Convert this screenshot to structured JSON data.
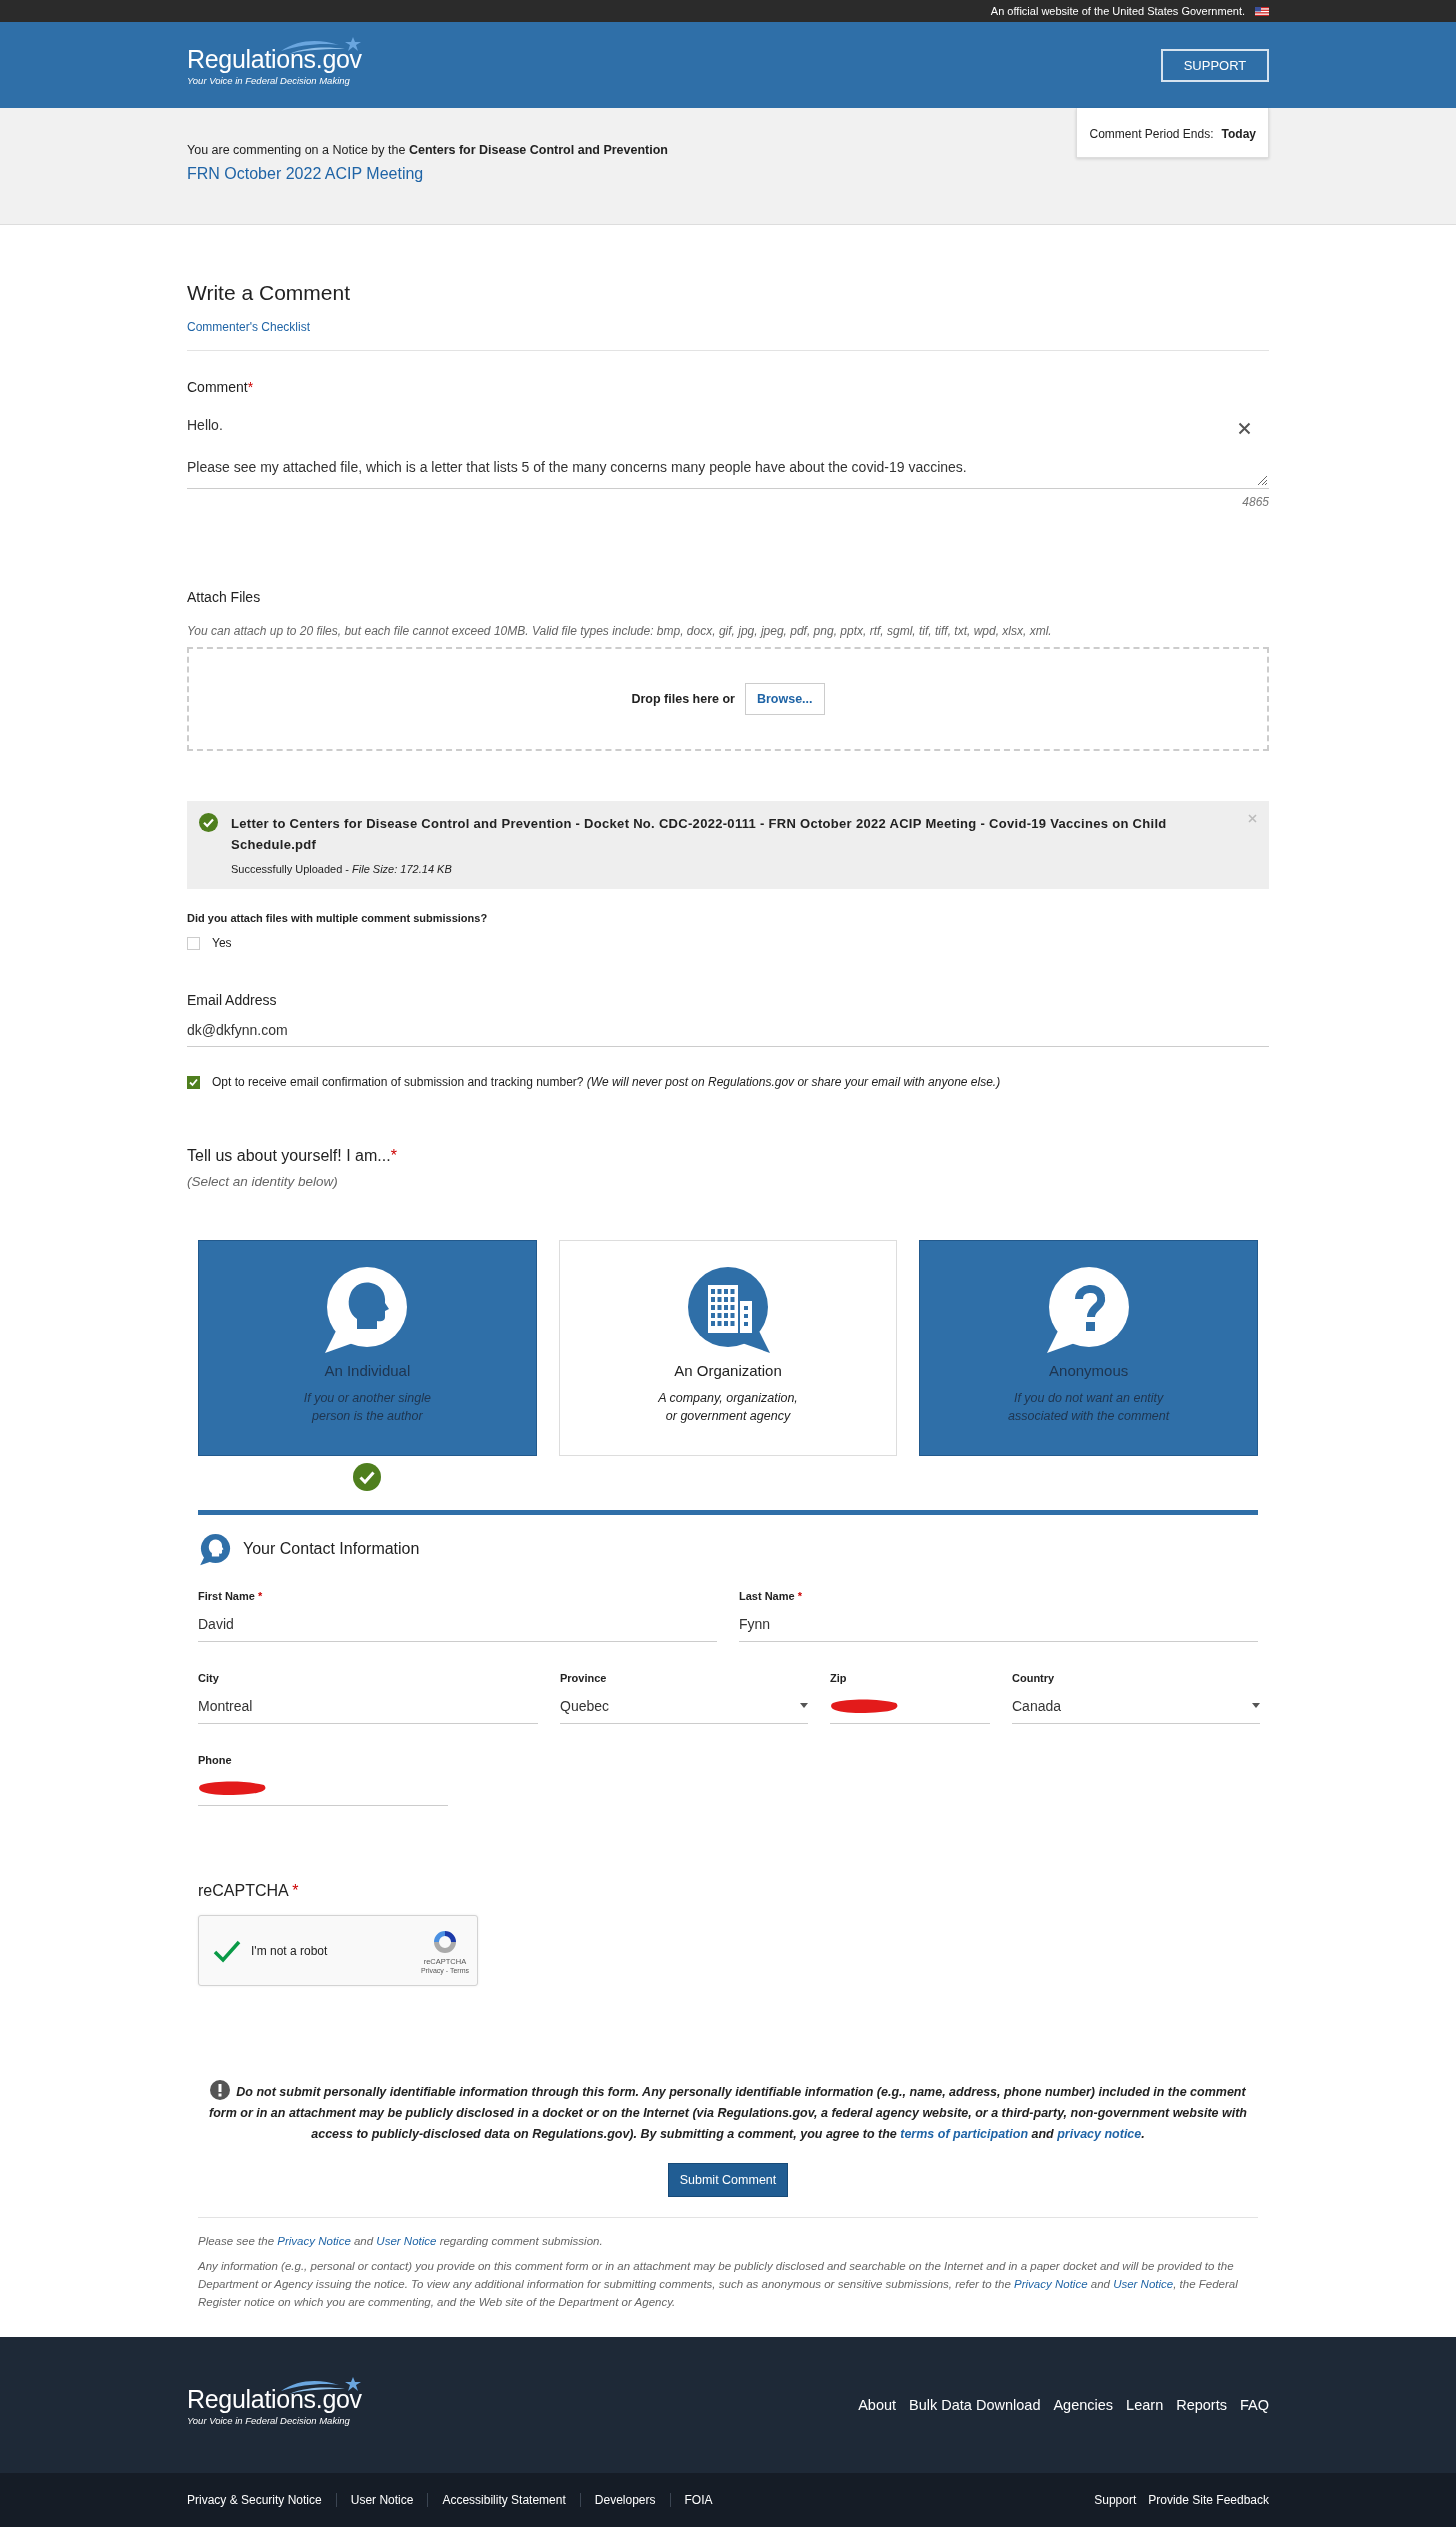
{
  "gov_banner": {
    "text": "An official website of the United States Government."
  },
  "header": {
    "logo": "Regulations.gov",
    "tagline": "Your Voice in Federal Decision Making",
    "support_button": "SUPPORT"
  },
  "notice": {
    "intro": "You are commenting on a Notice by the **Centers for Disease Control and Prevention**",
    "title": "FRN October 2022 ACIP Meeting",
    "period_label": "Comment Period Ends:",
    "period_value": "Today"
  },
  "write": {
    "heading": "Write a Comment",
    "checklist_link": "Commenter's Checklist"
  },
  "comment": {
    "label": "Comment",
    "required_mark": "*",
    "value": "Hello.\n\nPlease see my attached file, which is a letter that lists 5 of the many concerns many people have about the covid-19 vaccines.",
    "count": "4865"
  },
  "attach": {
    "label": "Attach Files",
    "hint": "You can attach up to 20 files, but each file cannot exceed 10MB. Valid file types include: bmp, docx, gif, jpg, jpeg, pdf, png, pptx, rtf, sgml, tif, tiff, txt, wpd, xlsx, xml.",
    "drop_text": "Drop files here or",
    "browse_button": "Browse..."
  },
  "files": [
    {
      "name": "Letter to Centers for Disease Control and Prevention - Docket No. CDC-2022-0111 - FRN October 2022 ACIP Meeting - Covid-19 Vaccines on Child Schedule.pdf",
      "status": "Successfully Uploaded - *File Size: 172.14 KB*"
    }
  ],
  "multiple": {
    "question": "Did you attach files with multiple comment submissions?",
    "options": [
      {
        "label": "Yes",
        "checked": false
      }
    ]
  },
  "email": {
    "label": "Email Address",
    "value": "dk@dkfynn.com",
    "opt_in": {
      "label": "Opt to receive email confirmation of submission and tracking number? *(We will never post on Regulations.gov or share your email with anyone else.)*",
      "checked": true
    }
  },
  "identity": {
    "heading": "Tell us about yourself! I am...",
    "required_mark": "*",
    "hint": "(Select an identity below)",
    "cards": [
      {
        "kind": "person",
        "title": "An Individual",
        "description": "If you or another single\nperson is the author",
        "highlighted": true,
        "selected": true
      },
      {
        "kind": "building",
        "title": "An Organization",
        "description": "A company, organization,\nor government agency",
        "highlighted": false,
        "selected": false
      },
      {
        "kind": "question",
        "title": "Anonymous",
        "description": "If you do not want an entity\nassociated with the comment",
        "highlighted": true,
        "selected": false
      }
    ]
  },
  "contact": {
    "heading": "Your Contact Information",
    "rows": [
      [
        {
          "label": "First Name",
          "required_mark": "*",
          "value": "David",
          "kind": "text"
        },
        {
          "label": "Last Name",
          "required_mark": "*",
          "value": "Fynn",
          "kind": "text"
        }
      ],
      [
        {
          "label": "City",
          "value": "Montreal",
          "kind": "text"
        },
        {
          "label": "Province",
          "value": "Quebec",
          "kind": "select"
        },
        {
          "label": "Zip",
          "kind": "text",
          "redacted": true
        },
        {
          "label": "Country",
          "value": "Canada",
          "kind": "select"
        }
      ],
      [
        {
          "label": "Phone",
          "kind": "text",
          "redacted": true
        }
      ]
    ]
  },
  "captcha": {
    "label": "reCAPTCHA",
    "required_mark": "*",
    "checkbox_label": "I'm not a robot",
    "checked": true,
    "brand": "reCAPTCHA",
    "links": "Privacy - Terms"
  },
  "disclaimer": [
    {
      "kind": "text",
      "text": "Do not submit personally identifiable information through this form. Any personally identifiable information (e.g., name, address, phone number) included in the comment form or in an attachment may be publicly disclosed in a docket or on the Internet (via Regulations.gov, a federal agency website, or a third-party, non-government website with access to publicly-disclosed data on Regulations.gov). By submitting a comment, you agree to the "
    },
    {
      "kind": "link",
      "text": "terms of participation"
    },
    {
      "kind": "text",
      "text": " and "
    },
    {
      "kind": "link",
      "text": "privacy notice"
    },
    {
      "kind": "text",
      "text": "."
    }
  ],
  "submit_button": "Submit Comment",
  "notes": [
    [
      {
        "kind": "text",
        "text": "Please see the "
      },
      {
        "kind": "link",
        "text": "Privacy Notice"
      },
      {
        "kind": "text",
        "text": " and "
      },
      {
        "kind": "link",
        "text": "User Notice"
      },
      {
        "kind": "text",
        "text": " regarding comment submission."
      }
    ],
    [
      {
        "kind": "text",
        "text": "Any information (e.g., personal or contact) you provide on this comment form or in an attachment may be publicly disclosed and searchable on the Internet and in a paper docket and will be provided to the Department or Agency issuing the notice. To view any additional information for submitting comments, such as anonymous or sensitive submissions, refer to the "
      },
      {
        "kind": "link",
        "text": "Privacy Notice"
      },
      {
        "kind": "text",
        "text": " and "
      },
      {
        "kind": "link",
        "text": "User Notice"
      },
      {
        "kind": "text",
        "text": ", the Federal Register notice on which you are commenting, and the Web site of the Department or Agency."
      }
    ]
  ],
  "footer": {
    "logo": "Regulations.gov",
    "tagline": "Your Voice in Federal Decision Making",
    "nav": [
      "About",
      "Bulk Data Download",
      "Agencies",
      "Learn",
      "Reports",
      "FAQ"
    ],
    "bottom_left": [
      "Privacy & Security Notice",
      "User Notice",
      "Accessibility Statement",
      "Developers",
      "FOIA"
    ],
    "bottom_right": [
      "Support",
      "Provide Site Feedback"
    ]
  }
}
